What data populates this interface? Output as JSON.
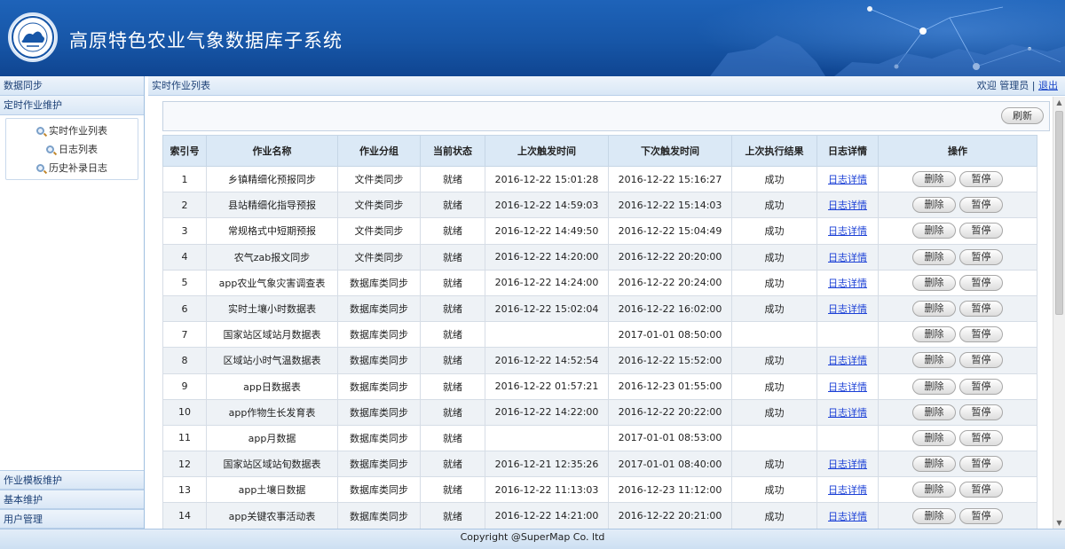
{
  "header": {
    "title": "高原特色农业气象数据库子系统",
    "logo_icon": "meteorological-seal-logo"
  },
  "sidebar": {
    "top_sections": [
      "数据同步",
      "定时作业维护"
    ],
    "sub_items": [
      {
        "label": "实时作业列表",
        "icon": "magnifier-icon"
      },
      {
        "label": "日志列表",
        "icon": "magnifier-icon"
      },
      {
        "label": "历史补录日志",
        "icon": "magnifier-icon"
      }
    ],
    "bottom_sections": [
      "作业模板维护",
      "基本维护",
      "用户管理"
    ]
  },
  "main": {
    "title": "实时作业列表",
    "welcome": "欢迎 管理员 |",
    "logout": "退出",
    "refresh_label": "刷新"
  },
  "table": {
    "headers": [
      "索引号",
      "作业名称",
      "作业分组",
      "当前状态",
      "上次触发时间",
      "下次触发时间",
      "上次执行结果",
      "日志详情",
      "操作"
    ],
    "delete_label": "删除",
    "pause_label": "暂停",
    "rows": [
      [
        "1",
        "乡镇精细化预报同步",
        "文件类同步",
        "就绪",
        "2016-12-22 15:01:28",
        "2016-12-22 15:16:27",
        "成功",
        "日志详情"
      ],
      [
        "2",
        "县站精细化指导预报",
        "文件类同步",
        "就绪",
        "2016-12-22 14:59:03",
        "2016-12-22 15:14:03",
        "成功",
        "日志详情"
      ],
      [
        "3",
        "常规格式中短期预报",
        "文件类同步",
        "就绪",
        "2016-12-22 14:49:50",
        "2016-12-22 15:04:49",
        "成功",
        "日志详情"
      ],
      [
        "4",
        "农气zab报文同步",
        "文件类同步",
        "就绪",
        "2016-12-22 14:20:00",
        "2016-12-22 20:20:00",
        "成功",
        "日志详情"
      ],
      [
        "5",
        "app农业气象灾害调查表",
        "数据库类同步",
        "就绪",
        "2016-12-22 14:24:00",
        "2016-12-22 20:24:00",
        "成功",
        "日志详情"
      ],
      [
        "6",
        "实时土壤小时数据表",
        "数据库类同步",
        "就绪",
        "2016-12-22 15:02:04",
        "2016-12-22 16:02:00",
        "成功",
        "日志详情"
      ],
      [
        "7",
        "国家站区域站月数据表",
        "数据库类同步",
        "就绪",
        "",
        "2017-01-01 08:50:00",
        "",
        ""
      ],
      [
        "8",
        "区域站小时气温数据表",
        "数据库类同步",
        "就绪",
        "2016-12-22 14:52:54",
        "2016-12-22 15:52:00",
        "成功",
        "日志详情"
      ],
      [
        "9",
        "app日数据表",
        "数据库类同步",
        "就绪",
        "2016-12-22 01:57:21",
        "2016-12-23 01:55:00",
        "成功",
        "日志详情"
      ],
      [
        "10",
        "app作物生长发育表",
        "数据库类同步",
        "就绪",
        "2016-12-22 14:22:00",
        "2016-12-22 20:22:00",
        "成功",
        "日志详情"
      ],
      [
        "11",
        "app月数据",
        "数据库类同步",
        "就绪",
        "",
        "2017-01-01 08:53:00",
        "",
        ""
      ],
      [
        "12",
        "国家站区域站旬数据表",
        "数据库类同步",
        "就绪",
        "2016-12-21 12:35:26",
        "2017-01-01 08:40:00",
        "成功",
        "日志详情"
      ],
      [
        "13",
        "app土壤日数据",
        "数据库类同步",
        "就绪",
        "2016-12-22 11:13:03",
        "2016-12-23 11:12:00",
        "成功",
        "日志详情"
      ],
      [
        "14",
        "app关键农事活动表",
        "数据库类同步",
        "就绪",
        "2016-12-22 14:21:00",
        "2016-12-22 20:21:00",
        "成功",
        "日志详情"
      ]
    ]
  },
  "footer": {
    "copyright": "Copyright @SuperMap Co. ltd"
  },
  "colors": {
    "header_blue": "#1756a7",
    "table_header": "#dbe9f6",
    "link_blue": "#1a3fd6"
  }
}
